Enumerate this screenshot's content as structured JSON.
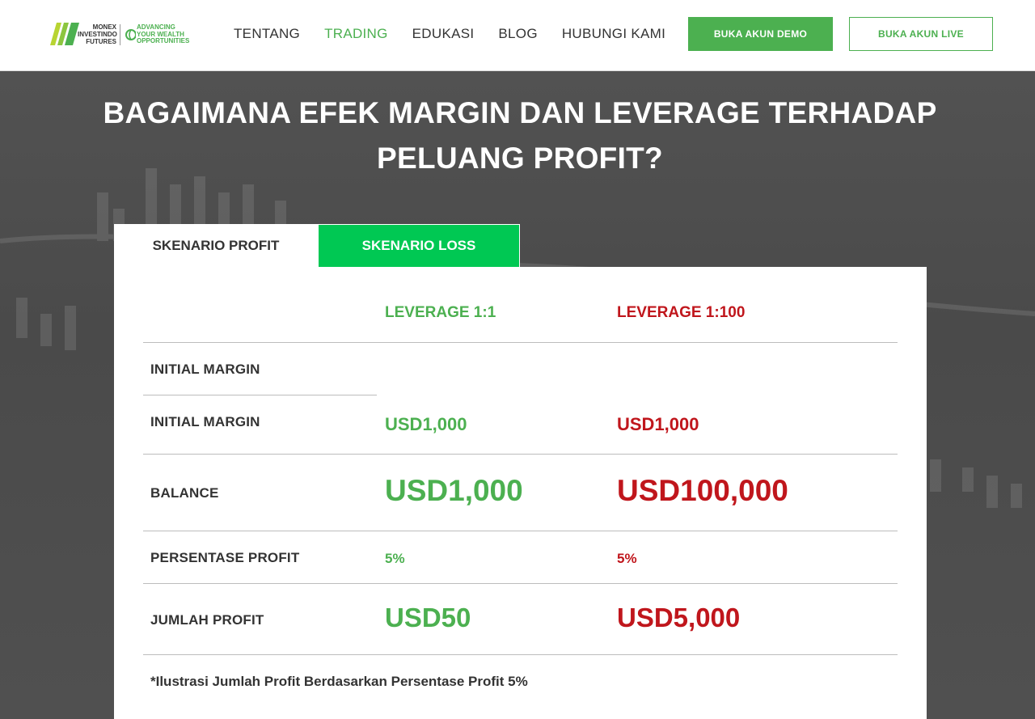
{
  "logo": {
    "line1": "MONEX",
    "line2": "INVESTINDO",
    "line3": "FUTURES",
    "tag1": "ADVANCING",
    "tag2": "YOUR WEALTH",
    "tag3": "OPPORTUNITIES"
  },
  "nav": {
    "items": [
      {
        "label": "TENTANG"
      },
      {
        "label": "TRADING"
      },
      {
        "label": "EDUKASI"
      },
      {
        "label": "BLOG"
      },
      {
        "label": "HUBUNGI KAMI"
      }
    ],
    "active": "TRADING"
  },
  "buttons": {
    "demo": "BUKA AKUN DEMO",
    "live": "BUKA AKUN LIVE"
  },
  "hero": {
    "title_line1": "BAGAIMANA EFEK MARGIN DAN LEVERAGE TERHADAP",
    "title_line2": "PELUANG PROFIT?"
  },
  "tabs": {
    "profit": "SKENARIO PROFIT",
    "loss": "SKENARIO LOSS"
  },
  "table": {
    "col1_header": "LEVERAGE 1:1",
    "col2_header": "LEVERAGE 1:100",
    "rows": [
      {
        "label": "INITIAL MARGIN",
        "v1": "",
        "v2": ""
      },
      {
        "label": "INITIAL MARGIN",
        "v1": "USD1,000",
        "v2": "USD1,000"
      },
      {
        "label": "BALANCE",
        "v1": "USD1,000",
        "v2": "USD100,000"
      },
      {
        "label": "PERSENTASE PROFIT",
        "v1": "5%",
        "v2": "5%"
      },
      {
        "label": "JUMLAH PROFIT",
        "v1": "USD50",
        "v2": "USD5,000"
      }
    ],
    "note": "*Ilustrasi Jumlah Profit Berdasarkan Persentase Profit 5%"
  },
  "colors": {
    "brand_green": "#4cb050",
    "tab_green": "#00c853",
    "loss_red": "#c0161c"
  }
}
